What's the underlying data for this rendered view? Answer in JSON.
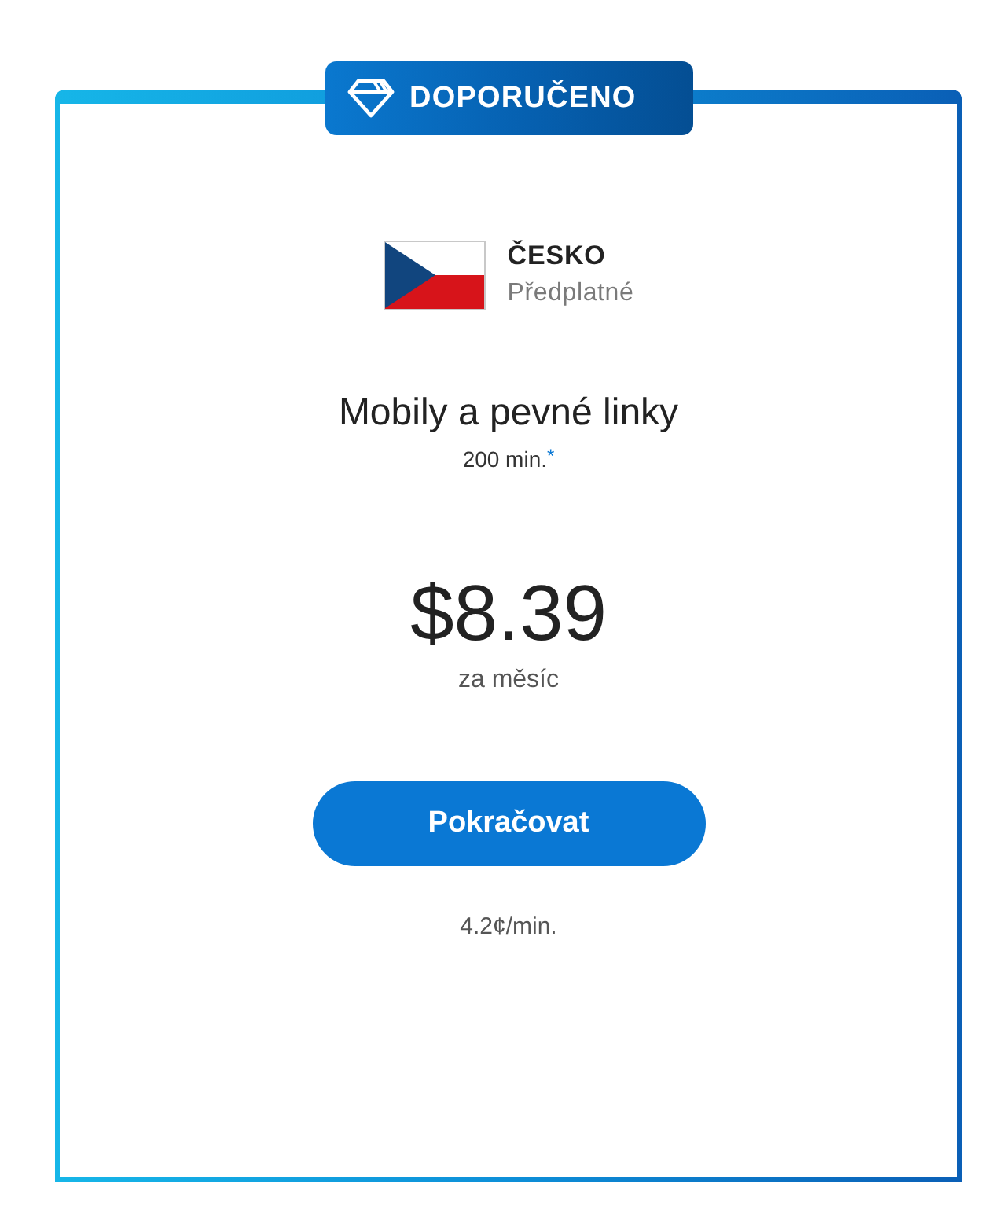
{
  "badge": {
    "label": "DOPORUČENO"
  },
  "plan": {
    "country": "ČESKO",
    "type": "Předplatné"
  },
  "offer": {
    "title": "Mobily a pevné linky",
    "minutes": "200 min.$^{*}$"
  },
  "price": {
    "amount": "$8.39",
    "period": "za měsíc"
  },
  "button": {
    "label": "Pokračovat"
  },
  "rate": "4.2¢/min."
}
